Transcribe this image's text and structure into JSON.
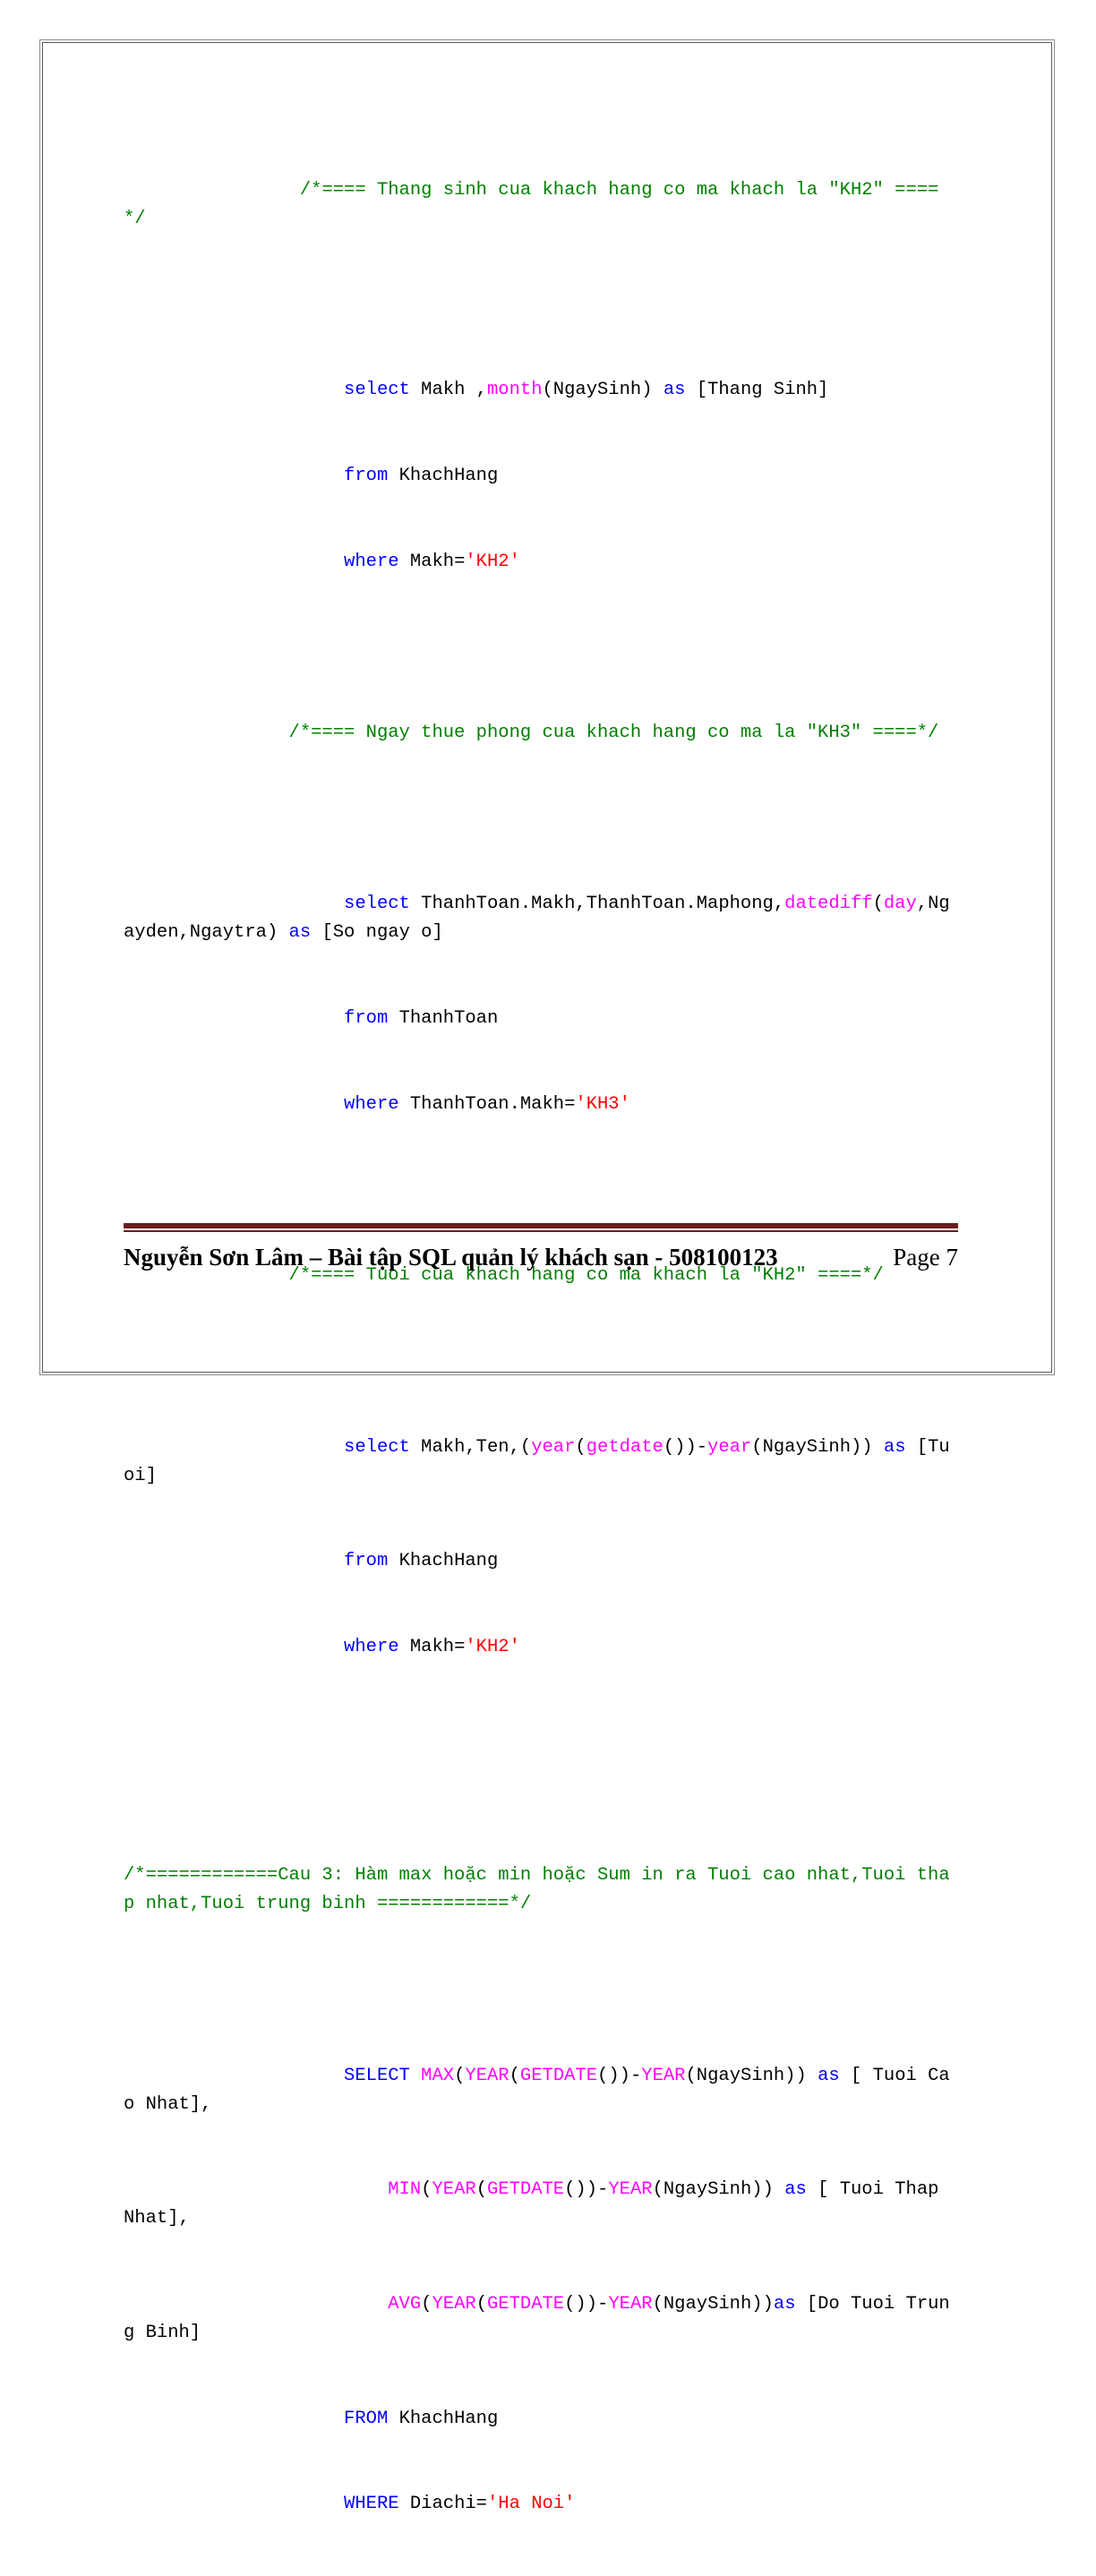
{
  "document": {
    "page_label": "Page 7",
    "footer_text": "Nguyễn Sơn Lâm – Bài tập SQL quản lý khách sạn - 508100123"
  },
  "colors": {
    "comment": "#008000",
    "keyword": "#0000ff",
    "function": "#ff00ff",
    "string": "#ff0000",
    "plain": "#000000",
    "footer_rule": "#6b1f1f",
    "page_border": "#5a5a5a"
  },
  "code": {
    "block1": {
      "comment_line1": "                /*==== Thang sinh cua khach hang co ma khach la \"KH2\" ====*/",
      "select_kw": "select",
      "select_rest": " Makh ,",
      "fn_month": "month",
      "after_month": "(NgaySinh) ",
      "as_kw": "as",
      "alias": " [Thang Sinh]",
      "from_kw": "from",
      "from_rest": " KhachHang",
      "where_kw": "where",
      "where_rest": " Makh=",
      "where_str": "'KH2'",
      "indent": "                    "
    },
    "block2": {
      "comment_line1": "               /*==== Ngay thue phong cua khach hang co ma la \"KH3\" ====*/",
      "select_kw": "select",
      "cols_a": " ThanhToan.Makh,ThanhToan.Maphong,",
      "fn_datediff": "datediff",
      "paren_open": "(",
      "arg_day": "day",
      "cols_b": ",Ngayden,Ngaytra",
      "paren_close": ") ",
      "as_kw": "as",
      "alias": " [So ngay o]",
      "from_kw": "from",
      "from_rest": " ThanhToan",
      "where_kw": "where",
      "where_rest": " ThanhToan.Makh=",
      "where_str": "'KH3'",
      "indent": "                    "
    },
    "block3": {
      "comment_line1": "               /*==== Tuoi cua khach hang co ma khach la \"KH2\" ====*/",
      "select_kw": "select",
      "cols_a": " Makh,Ten,(",
      "fn_year1": "year",
      "mid1": "(",
      "fn_getdate": "getdate",
      "mid2": "())-",
      "fn_year2": "year",
      "mid3": "(NgaySinh)) ",
      "as_kw": "as",
      "alias": " [Tuoi]",
      "from_kw": "from",
      "from_rest": " KhachHang",
      "where_kw": "where",
      "where_rest": " Makh=",
      "where_str": "'KH2'",
      "indent": "                    "
    },
    "block4": {
      "comment_header": "/*============Cau 3: Hàm max hoặc min hoặc Sum in ra Tuoi cao nhat,Tuoi thap nhat,Tuoi trung binh ============*/",
      "select_kw": "SELECT",
      "sp": " ",
      "fn_max": "MAX",
      "open1": "(",
      "fn_year_a": "YEAR",
      "mid_a": "(",
      "fn_getdate_a": "GETDATE",
      "mid_b": "())-",
      "fn_year_b": "YEAR",
      "mid_c": "(NgaySinh)) ",
      "as_kw": "as",
      "alias_max": " [ Tuoi Cao Nhat],",
      "fn_min": "MIN",
      "alias_min": " [ Tuoi Thap Nhat],",
      "fn_avg": "AVG",
      "mid_c_avg": "(NgaySinh))",
      "alias_avg": " [Do Tuoi Trung Binh]",
      "from_kw": "FROM",
      "from_rest": " KhachHang",
      "where_kw": "WHERE",
      "where_rest": " Diachi=",
      "where_str": "'Ha Noi'",
      "indent": "                    ",
      "indent2": "                        "
    }
  }
}
